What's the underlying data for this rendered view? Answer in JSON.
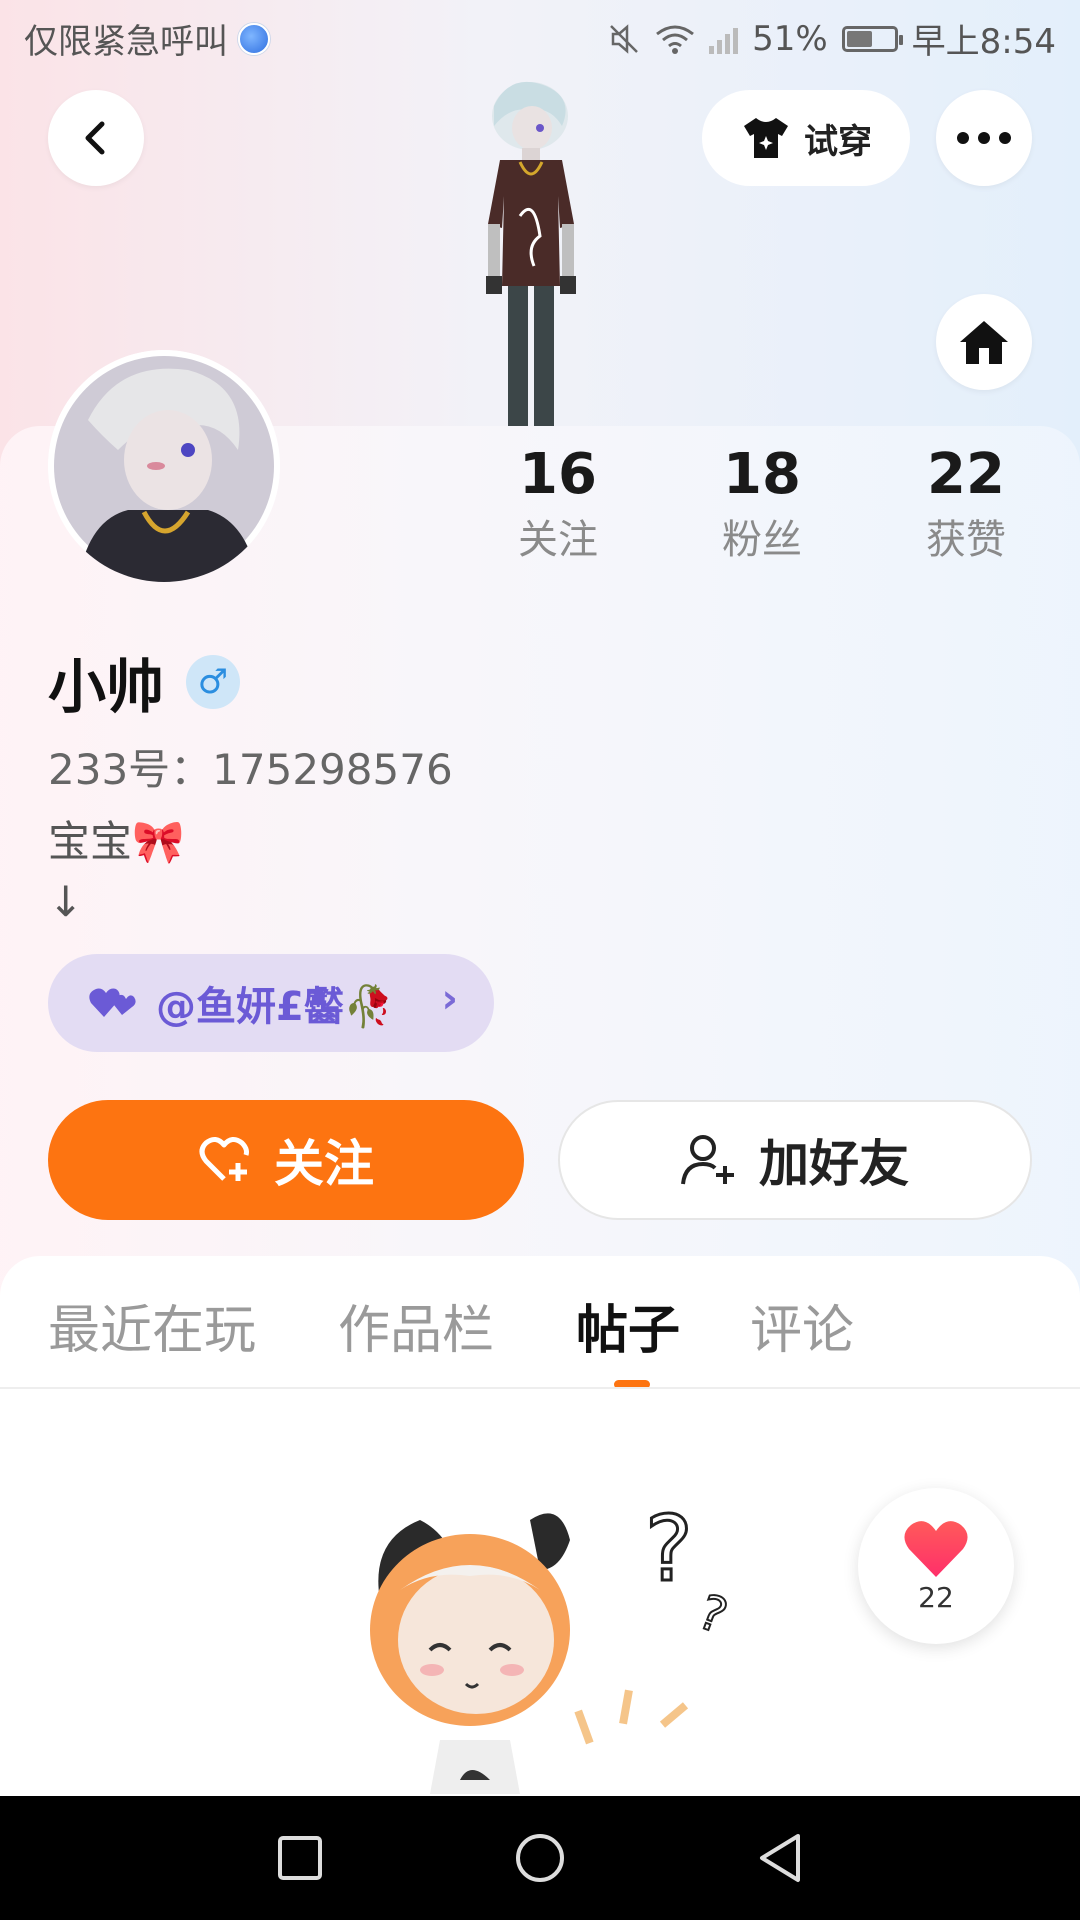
{
  "status_bar": {
    "carrier_text": "仅限紧急呼叫",
    "battery_percent": "51%",
    "time": "早上8:54",
    "icons": [
      "globe-icon",
      "mute-icon",
      "wifi-icon",
      "signal-icon",
      "battery-icon"
    ]
  },
  "header": {
    "back_icon": "chevron-left-icon",
    "tryon_label": "试穿",
    "tryon_icon": "shirt-icon",
    "more_icon": "more-icon",
    "home_icon": "home-icon"
  },
  "profile": {
    "stats": [
      {
        "value": "16",
        "label": "关注"
      },
      {
        "value": "18",
        "label": "粉丝"
      },
      {
        "value": "22",
        "label": "获赞"
      }
    ],
    "name": "小帅",
    "gender_symbol": "♂",
    "uid_text": "233号：175298576",
    "bio_line1": "宝宝🎀",
    "bio_line2": "↓",
    "partner_text": "@鱼妍£齾🥀",
    "partner_chevron": "›"
  },
  "actions": {
    "follow_label": "关注",
    "add_friend_label": "加好友"
  },
  "tabs": [
    {
      "label": "最近在玩",
      "active": false
    },
    {
      "label": "作品栏",
      "active": false
    },
    {
      "label": "帖子",
      "active": true
    },
    {
      "label": "评论",
      "active": false
    }
  ],
  "like_fab": {
    "count": "22"
  },
  "colors": {
    "accent": "#fd7411",
    "partner_chip_bg": "#e3dcf3",
    "partner_text": "#6b5ad6"
  }
}
